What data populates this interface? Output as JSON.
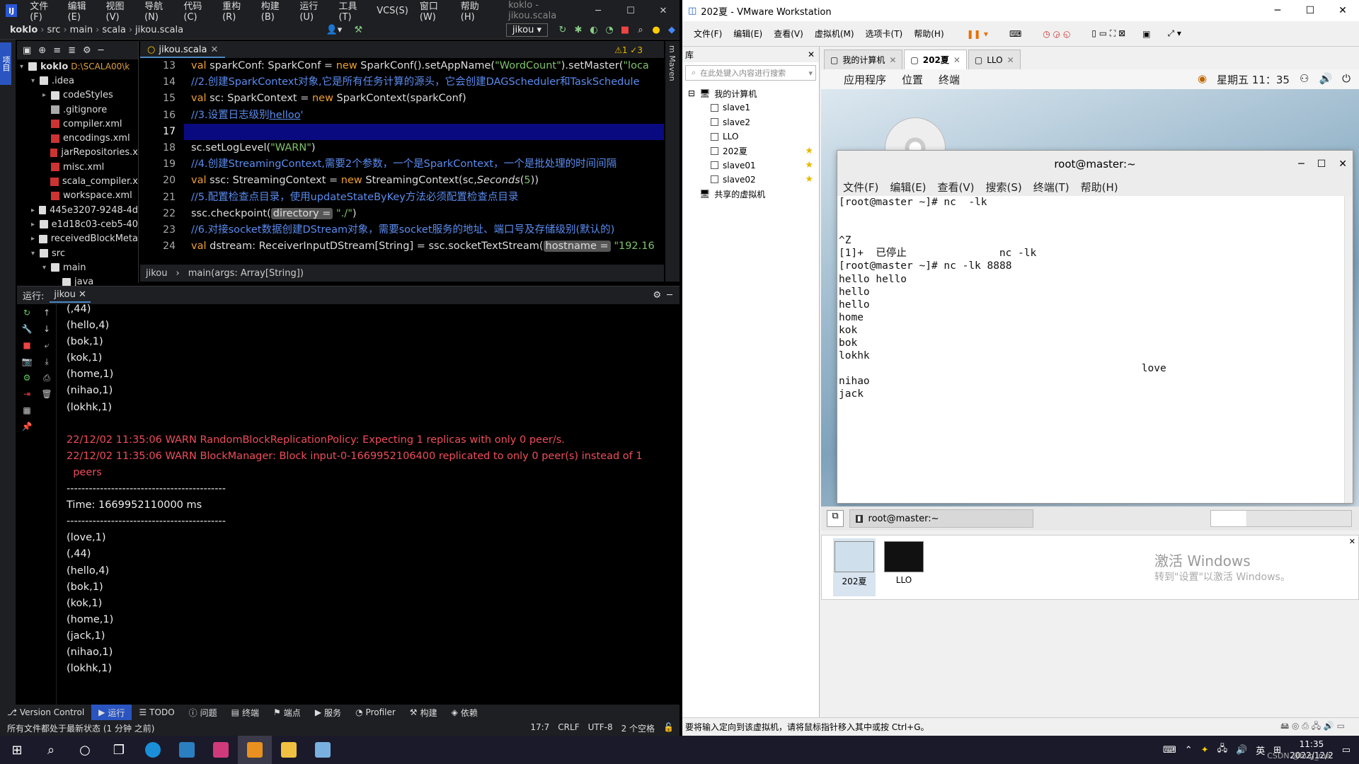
{
  "idea": {
    "menu": [
      "文件(F)",
      "编辑(E)",
      "视图(V)",
      "导航(N)",
      "代码(C)",
      "重构(R)",
      "构建(B)",
      "运行(U)",
      "工具(T)",
      "VCS(S)",
      "窗口(W)",
      "帮助(H)"
    ],
    "window_title": "koklo - jikou.scala",
    "breadcrumb": [
      "koklo",
      "src",
      "main",
      "scala",
      "jikou.scala"
    ],
    "run_config": "jikou",
    "left_strip_label": "项目",
    "project": {
      "root": "koklo",
      "root_path": "D:\\SCALA00\\k",
      "tree": [
        {
          "label": ".idea",
          "depth": 1,
          "arrow": "▾",
          "icon": "folder"
        },
        {
          "label": "codeStyles",
          "depth": 2,
          "arrow": "▸",
          "icon": "folder"
        },
        {
          "label": ".gitignore",
          "depth": 2,
          "arrow": "",
          "icon": "file"
        },
        {
          "label": "compiler.xml",
          "depth": 2,
          "arrow": "",
          "icon": "xml"
        },
        {
          "label": "encodings.xml",
          "depth": 2,
          "arrow": "",
          "icon": "xml"
        },
        {
          "label": "jarRepositories.x",
          "depth": 2,
          "arrow": "",
          "icon": "xml"
        },
        {
          "label": "misc.xml",
          "depth": 2,
          "arrow": "",
          "icon": "xml"
        },
        {
          "label": "scala_compiler.x",
          "depth": 2,
          "arrow": "",
          "icon": "xml"
        },
        {
          "label": "workspace.xml",
          "depth": 2,
          "arrow": "",
          "icon": "xml"
        },
        {
          "label": "445e3207-9248-4d",
          "depth": 1,
          "arrow": "▸",
          "icon": "folder"
        },
        {
          "label": "e1d18c03-ceb5-40",
          "depth": 1,
          "arrow": "▸",
          "icon": "folder"
        },
        {
          "label": "receivedBlockMeta",
          "depth": 1,
          "arrow": "▸",
          "icon": "folder"
        },
        {
          "label": "src",
          "depth": 1,
          "arrow": "▾",
          "icon": "folder"
        },
        {
          "label": "main",
          "depth": 2,
          "arrow": "▾",
          "icon": "folder"
        },
        {
          "label": "java",
          "depth": 3,
          "arrow": "",
          "icon": "folder"
        }
      ]
    },
    "editor": {
      "tab": "jikou.scala",
      "inspection": "⚠1  ✓3",
      "lines": [
        {
          "n": "13",
          "html": "<span class='kw'>val</span> sparkConf: SparkConf = <span class='kw'>new</span> SparkConf().setAppName(<span class='str'>\"WordCount\"</span>).setMaster(<span class='str'>\"loca</span>"
        },
        {
          "n": "14",
          "html": "<span class='cm'>//2.创建SparkContext对象,它是所有任务计算的源头，它会创建DAGScheduler和TaskSchedule</span>"
        },
        {
          "n": "15",
          "html": "<span class='kw'>val</span> sc: SparkContext = <span class='kw'>new</span> SparkContext(sparkConf)"
        },
        {
          "n": "16",
          "html": "<span class='cm'>//3.设置日志级别<u>helloo</u>'</span>"
        },
        {
          "n": "17",
          "html": ""
        },
        {
          "n": "18",
          "html": "sc.setLogLevel(<span class='str'>\"WARN\"</span>)"
        },
        {
          "n": "19",
          "html": "<span class='cm'>//4.创建StreamingContext,需要2个参数，一个是SparkContext，一个是批处理的时间间隔</span>"
        },
        {
          "n": "20",
          "html": "<span class='kw'>val</span> ssc: StreamingContext = <span class='kw'>new</span> StreamingContext(sc,<i>Seconds</i>(<span class='str'>5</span>))"
        },
        {
          "n": "21",
          "html": "<span class='cm'>//5.配置检查点目录，使用updateStateByKey方法必须配置检查点目录</span>"
        },
        {
          "n": "22",
          "html": "ssc.checkpoint(<span class='hint'>directory =</span> <span class='str'>\"./\"</span>)"
        },
        {
          "n": "23",
          "html": "<span class='cm'>//6.对接socket数据创建DStream对象，需要socket服务的地址、端口号及存储级别(默认的)</span>"
        },
        {
          "n": "24",
          "html": "<span class='kw'>val</span> dstream: ReceiverInputDStream[String] = ssc.socketTextStream(<span class='hint'>hostname =</span> <span class='str'>\"192.16</span>"
        }
      ],
      "current_line": "17",
      "method_crumbs": [
        "jikou",
        "main(args: Array[String])"
      ]
    },
    "run": {
      "label": "运行:",
      "tab": "jikou",
      "output": [
        {
          "t": "(,44)",
          "c": ""
        },
        {
          "t": "(hello,4)",
          "c": ""
        },
        {
          "t": "(bok,1)",
          "c": ""
        },
        {
          "t": "(kok,1)",
          "c": ""
        },
        {
          "t": "(home,1)",
          "c": ""
        },
        {
          "t": "(nihao,1)",
          "c": ""
        },
        {
          "t": "(lokhk,1)",
          "c": ""
        },
        {
          "t": "",
          "c": ""
        },
        {
          "t": "22/12/02 11:35:06 WARN RandomBlockReplicationPolicy: Expecting 1 replicas with only 0 peer/s.",
          "c": "warn"
        },
        {
          "t": "22/12/02 11:35:06 WARN BlockManager: Block input-0-1669952106400 replicated to only 0 peer(s) instead of 1",
          "c": "warn"
        },
        {
          "t": "  peers",
          "c": "warn"
        },
        {
          "t": "-------------------------------------------",
          "c": ""
        },
        {
          "t": "Time: 1669952110000 ms",
          "c": ""
        },
        {
          "t": "-------------------------------------------",
          "c": ""
        },
        {
          "t": "(love,1)",
          "c": ""
        },
        {
          "t": "(,44)",
          "c": ""
        },
        {
          "t": "(hello,4)",
          "c": ""
        },
        {
          "t": "(bok,1)",
          "c": ""
        },
        {
          "t": "(kok,1)",
          "c": ""
        },
        {
          "t": "(home,1)",
          "c": ""
        },
        {
          "t": "(jack,1)",
          "c": ""
        },
        {
          "t": "(nihao,1)",
          "c": ""
        },
        {
          "t": "(lokhk,1)",
          "c": ""
        }
      ]
    },
    "tool_windows": [
      "Version Control",
      "运行",
      "TODO",
      "问题",
      "终端",
      "端点",
      "服务",
      "Profiler",
      "构建",
      "依赖"
    ],
    "status": {
      "message": "所有文件都处于最新状态 (1 分钟 之前)",
      "pos": "17:7",
      "eol": "CRLF",
      "encoding": "UTF-8",
      "indent": "2 个空格"
    }
  },
  "vmware": {
    "title": "202夏 - VMware Workstation",
    "menu": [
      "文件(F)",
      "编辑(E)",
      "查看(V)",
      "虚拟机(M)",
      "选项卡(T)",
      "帮助(H)"
    ],
    "library": {
      "header": "库",
      "search_placeholder": "在此处键入内容进行搜索",
      "root": "我的计算机",
      "vms": [
        {
          "name": "slave1",
          "star": ""
        },
        {
          "name": "slave2",
          "star": ""
        },
        {
          "name": "LLO",
          "star": ""
        },
        {
          "name": "202夏",
          "star": "★"
        },
        {
          "name": "slave01",
          "star": "★"
        },
        {
          "name": "slave02",
          "star": "★"
        }
      ],
      "shared": "共享的虚拟机"
    },
    "tabs": [
      {
        "label": "我的计算机",
        "active": false
      },
      {
        "label": "202夏",
        "active": true
      },
      {
        "label": "LLO",
        "active": false
      }
    ],
    "guest_menu": [
      "应用程序",
      "位置",
      "终端"
    ],
    "guest_clock": "星期五 11：35",
    "terminal": {
      "title": "root@master:~",
      "menu": [
        "文件(F)",
        "编辑(E)",
        "查看(V)",
        "搜索(S)",
        "终端(T)",
        "帮助(H)"
      ],
      "lines": [
        "[root@master ~]# nc  -lk",
        "",
        "",
        "^Z",
        "[1]+  已停止               nc -lk",
        "[root@master ~]# nc -lk 8888",
        "hello hello",
        "hello",
        "hello",
        "home",
        "kok",
        "bok",
        "lokhk",
        "                                                 love",
        "nihao",
        "jack"
      ]
    },
    "taskbar_item": "root@master:~",
    "thumbs": [
      "202夏",
      "LLO"
    ],
    "activate_title": "激活 Windows",
    "activate_sub": "转到\"设置\"以激活 Windows。",
    "status": "要将输入定向到该虚拟机，请将鼠标指针移入其中或按 Ctrl+G。"
  },
  "taskbar": {
    "ime": "英",
    "time": "11:35",
    "date": "2022/12/2",
    "watermark": "CSDN @bug_me"
  }
}
